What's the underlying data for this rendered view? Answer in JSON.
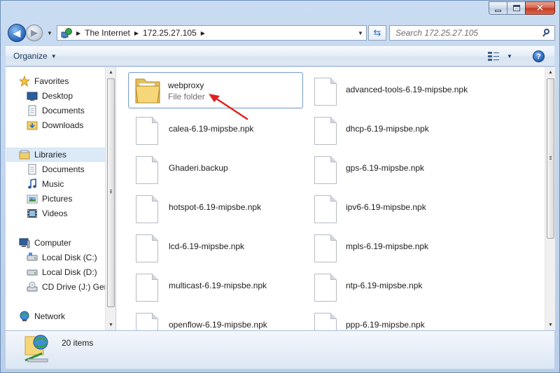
{
  "address": {
    "segments": [
      "The Internet",
      "172.25.27.105"
    ]
  },
  "search": {
    "placeholder": "Search 172.25.27.105"
  },
  "toolbar": {
    "organize_label": "Organize"
  },
  "nav": {
    "favorites": {
      "label": "Favorites",
      "items": [
        "Desktop",
        "Documents",
        "Downloads"
      ]
    },
    "libraries": {
      "label": "Libraries",
      "items": [
        "Documents",
        "Music",
        "Pictures",
        "Videos"
      ]
    },
    "computer": {
      "label": "Computer",
      "items": [
        "Local Disk (C:)",
        "Local Disk (D:)",
        "CD Drive (J:) Gerd"
      ]
    },
    "network": {
      "label": "Network"
    }
  },
  "files": {
    "folder": {
      "name": "webproxy",
      "type": "File folder"
    },
    "left_column": [
      "calea-6.19-mipsbe.npk",
      "Ghaderi.backup",
      "hotspot-6.19-mipsbe.npk",
      "lcd-6.19-mipsbe.npk",
      "multicast-6.19-mipsbe.npk",
      "openflow-6.19-mipsbe.npk"
    ],
    "right_column": [
      "advanced-tools-6.19-mipsbe.npk",
      "dhcp-6.19-mipsbe.npk",
      "gps-6.19-mipsbe.npk",
      "ipv6-6.19-mipsbe.npk",
      "mpls-6.19-mipsbe.npk",
      "ntp-6.19-mipsbe.npk",
      "ppp-6.19-mipsbe.npk"
    ]
  },
  "status": {
    "item_count": "20 items"
  },
  "colors": {
    "annotation_arrow": "#e02020",
    "selection_border": "#7da2ce"
  }
}
